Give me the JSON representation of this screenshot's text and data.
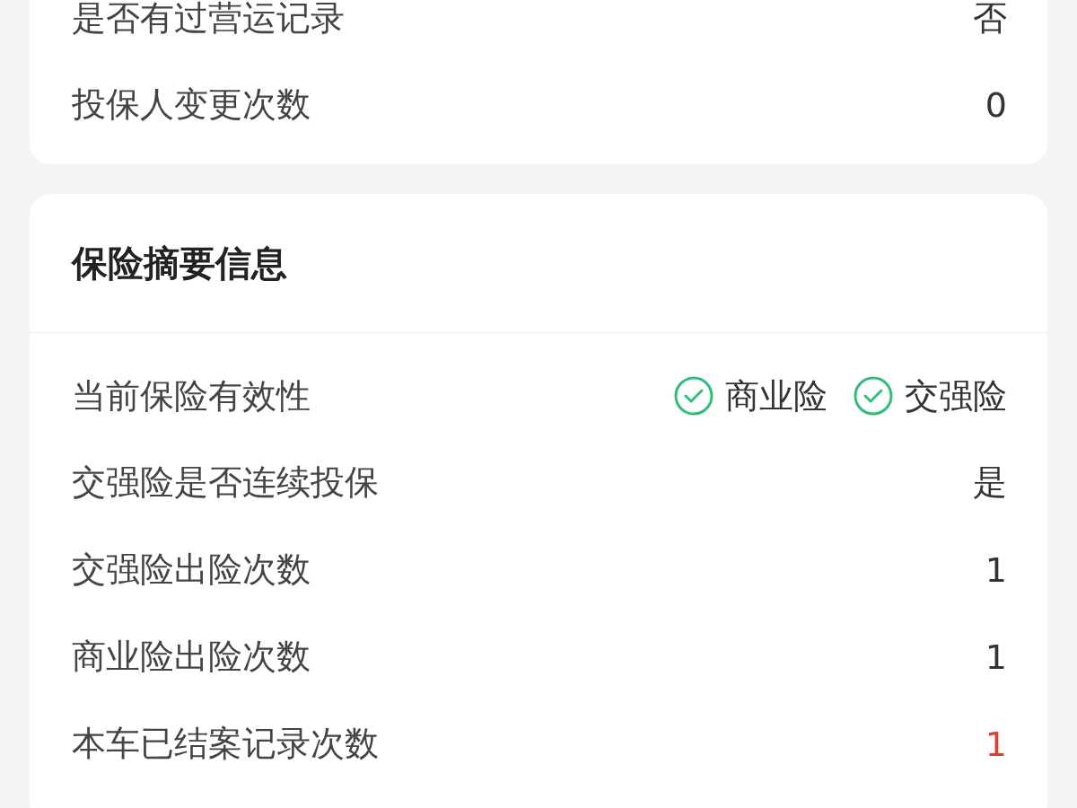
{
  "cards": [
    {
      "rows": [
        {
          "kind": "text",
          "label": "是否有过营运记录",
          "value": "否",
          "alert": false
        },
        {
          "kind": "text",
          "label": "投保人变更次数",
          "value": "0",
          "alert": false
        }
      ]
    },
    {
      "title": "保险摘要信息",
      "rows": [
        {
          "kind": "badges",
          "label": "当前保险有效性",
          "items": [
            {
              "label": "商业险",
              "checked": true
            },
            {
              "label": "交强险",
              "checked": true
            }
          ]
        },
        {
          "kind": "text",
          "label": "交强险是否连续投保",
          "value": "是",
          "alert": false
        },
        {
          "kind": "text",
          "label": "交强险出险次数",
          "value": "1",
          "alert": false
        },
        {
          "kind": "text",
          "label": "商业险出险次数",
          "value": "1",
          "alert": false
        },
        {
          "kind": "text",
          "label": "本车已结案记录次数",
          "value": "1",
          "alert": true
        }
      ]
    }
  ]
}
